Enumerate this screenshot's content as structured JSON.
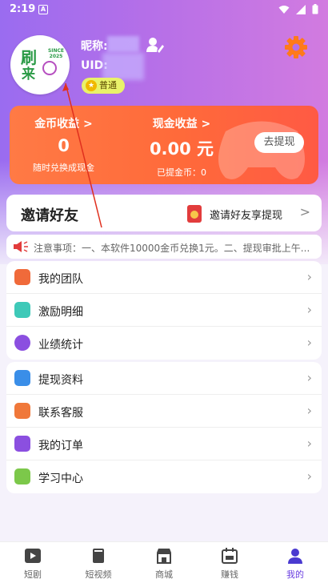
{
  "status_bar": {
    "time": "2:19",
    "notification_glyph": "A"
  },
  "profile": {
    "nickname_label": "昵称:",
    "uid_label": "UID:",
    "level_badge": "普通",
    "avatar_logo": {
      "line1": "刷",
      "line2": "来",
      "since": "SINCE 2025"
    }
  },
  "earnings": {
    "coin": {
      "title": "金币收益 >",
      "value": "0",
      "subtitle": "随时兑换成现金"
    },
    "cash": {
      "title": "现金收益 >",
      "value": "0.00 元",
      "subtitle": "已提金币：0"
    },
    "withdraw_button": "去提现"
  },
  "invite": {
    "title": "邀请好友",
    "link": "邀请好友享提现",
    "chevron": ">"
  },
  "notice": {
    "text": "注意事项：一、本软件10000金币兑换1元。二、提现审批上午..."
  },
  "menu_group_1": [
    {
      "label": "我的团队",
      "icon": "team-icon",
      "color": "#f06a3a"
    },
    {
      "label": "激励明细",
      "icon": "list-icon",
      "color": "#3ec9b8"
    },
    {
      "label": "业绩统计",
      "icon": "clock-icon",
      "color": "#8b4fe0"
    }
  ],
  "menu_group_2": [
    {
      "label": "提现资料",
      "icon": "monitor-icon",
      "color": "#3a8ee8"
    },
    {
      "label": "联系客服",
      "icon": "service-icon",
      "color": "#f0783a"
    },
    {
      "label": "我的订单",
      "icon": "order-icon",
      "color": "#8b4fe0"
    },
    {
      "label": "学习中心",
      "icon": "study-icon",
      "color": "#7cc84a"
    }
  ],
  "tabs": [
    {
      "label": "短剧",
      "icon": "play-icon",
      "active": false
    },
    {
      "label": "短视频",
      "icon": "book-icon",
      "active": false
    },
    {
      "label": "商城",
      "icon": "shop-icon",
      "active": false
    },
    {
      "label": "赚钱",
      "icon": "calendar-icon",
      "active": false
    },
    {
      "label": "我的",
      "icon": "person-icon",
      "active": true
    }
  ],
  "colors": {
    "accent": "#6a3ee0",
    "card": "#ff6a3a",
    "header": "#b56fe8"
  }
}
